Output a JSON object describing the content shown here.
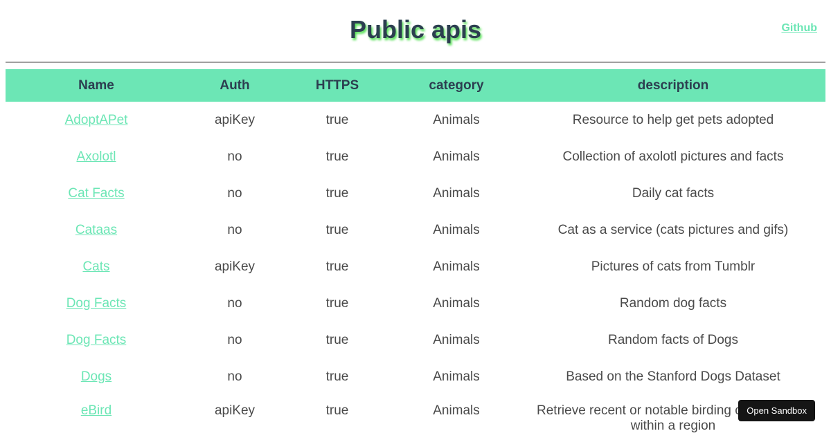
{
  "header": {
    "title": "Public apis",
    "github_link": "Github"
  },
  "table": {
    "columns": [
      "Name",
      "Auth",
      "HTTPS",
      "category",
      "description"
    ],
    "rows": [
      {
        "name": "AdoptAPet",
        "auth": "apiKey",
        "https": "true",
        "category": "Animals",
        "description": "Resource to help get pets adopted"
      },
      {
        "name": "Axolotl",
        "auth": "no",
        "https": "true",
        "category": "Animals",
        "description": "Collection of axolotl pictures and facts"
      },
      {
        "name": "Cat Facts",
        "auth": "no",
        "https": "true",
        "category": "Animals",
        "description": "Daily cat facts"
      },
      {
        "name": "Cataas",
        "auth": "no",
        "https": "true",
        "category": "Animals",
        "description": "Cat as a service (cats pictures and gifs)"
      },
      {
        "name": "Cats",
        "auth": "apiKey",
        "https": "true",
        "category": "Animals",
        "description": "Pictures of cats from Tumblr"
      },
      {
        "name": "Dog Facts",
        "auth": "no",
        "https": "true",
        "category": "Animals",
        "description": "Random dog facts"
      },
      {
        "name": "Dog Facts",
        "auth": "no",
        "https": "true",
        "category": "Animals",
        "description": "Random facts of Dogs"
      },
      {
        "name": "Dogs",
        "auth": "no",
        "https": "true",
        "category": "Animals",
        "description": "Based on the Stanford Dogs Dataset"
      },
      {
        "name": "eBird",
        "auth": "apiKey",
        "https": "true",
        "category": "Animals",
        "description": "Retrieve recent or notable birding observations within a region"
      }
    ]
  },
  "sandbox_button": "Open Sandbox",
  "colors": {
    "accent": "#6ce6b5",
    "heading": "#2c3e50",
    "text": "#4a4a4a"
  }
}
